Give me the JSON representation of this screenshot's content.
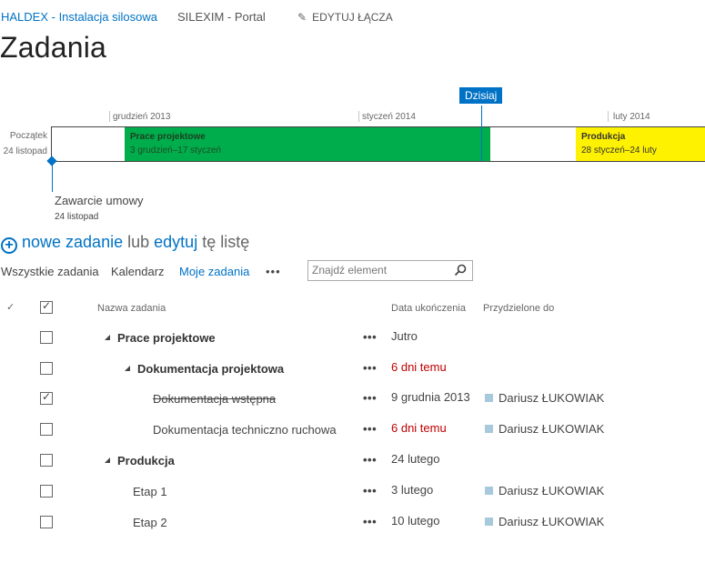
{
  "top_nav": {
    "site_title": "HALDEX - Instalacja silosowa",
    "portal": "SILEXIM - Portal",
    "edit_links": "EDYTUJ ŁĄCZA"
  },
  "page": {
    "title": "Zadania"
  },
  "timeline": {
    "months": [
      "grudzień 2013",
      "styczeń 2014",
      "luty 2014"
    ],
    "start_label": "Początek",
    "start_date": "24 listopad",
    "today_label": "Dzisiaj",
    "bars": [
      {
        "title": "Prace projektowe",
        "dates": "3 grudzień–17 styczeń",
        "color": "#00ad4d"
      },
      {
        "title": "Produkcja",
        "dates": "28 styczeń–24 luty",
        "color": "#fff200"
      }
    ],
    "milestone": {
      "title": "Zawarcie umowy",
      "date": "24 listopad"
    }
  },
  "new_task": {
    "new_label": "nowe zadanie",
    "or_label": "lub",
    "edit_label": "edytuj",
    "list_label": "tę listę"
  },
  "views": {
    "tabs": [
      "Wszystkie zadania",
      "Kalendarz",
      "Moje zadania"
    ],
    "active": "Moje zadania",
    "more": "•••",
    "search_placeholder": "Znajdź element"
  },
  "table": {
    "headers": {
      "name": "Nazwa zadania",
      "due": "Data ukończenia",
      "assigned": "Przydzielone do"
    },
    "rows": [
      {
        "name": "Prace projektowe",
        "due": "Jutro",
        "assigned": "",
        "checked": false,
        "late": false
      },
      {
        "name": "Dokumentacja projektowa",
        "due": "6 dni temu",
        "assigned": "",
        "checked": false,
        "late": true
      },
      {
        "name": "Dokumentacja wstępna",
        "due": "9 grudnia 2013",
        "assigned": "Dariusz ŁUKOWIAK",
        "checked": true,
        "late": false
      },
      {
        "name": "Dokumentacja techniczno ruchowa",
        "due": "6 dni temu",
        "assigned": "Dariusz ŁUKOWIAK",
        "checked": false,
        "late": true
      },
      {
        "name": "Produkcja",
        "due": "24 lutego",
        "assigned": "",
        "checked": false,
        "late": false
      },
      {
        "name": "Etap 1",
        "due": "3 lutego",
        "assigned": "Dariusz ŁUKOWIAK",
        "checked": false,
        "late": false
      },
      {
        "name": "Etap 2",
        "due": "10 lutego",
        "assigned": "Dariusz ŁUKOWIAK",
        "checked": false,
        "late": false
      }
    ],
    "row_more": "•••"
  },
  "colors": {
    "accent": "#0072c6",
    "late": "#bf0000",
    "summary_bar_1": "#00ad4d",
    "summary_bar_2": "#fff200"
  }
}
